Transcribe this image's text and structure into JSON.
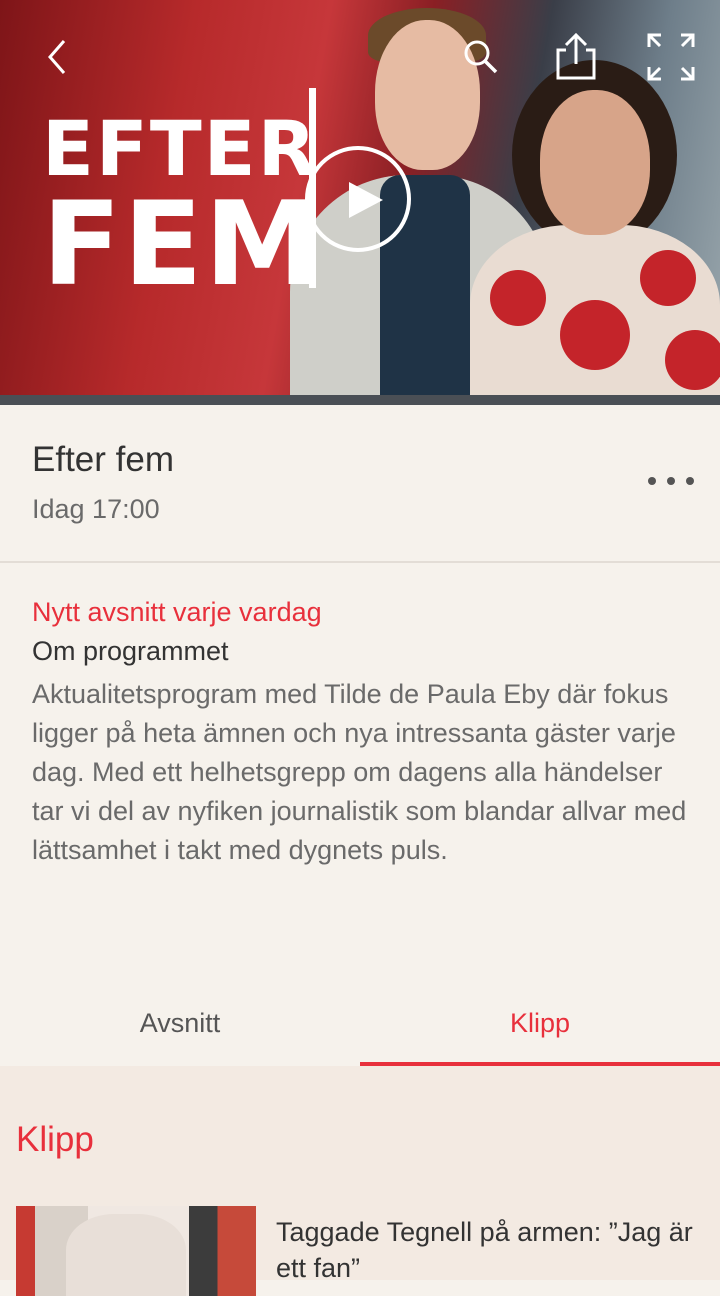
{
  "hero": {
    "logo_line1": "EFTER",
    "logo_line2": "FEM",
    "icons": [
      "back-icon",
      "search-icon",
      "share-icon",
      "fullscreen-icon",
      "play-icon"
    ]
  },
  "program": {
    "title": "Efter fem",
    "airtime": "Idag 17:00"
  },
  "about": {
    "tagline": "Nytt avsnitt varje vardag",
    "heading": "Om programmet",
    "text": "Aktualitetsprogram med Tilde de Paula Eby där fokus ligger på heta ämnen och nya intressanta gäster varje dag. Med ett helhetsgrepp om dagens alla händelser tar vi del av nyfiken journalistik som blandar allvar med lättsamhet i takt med dygnets puls."
  },
  "tabs": [
    {
      "label": "Avsnitt",
      "active": false
    },
    {
      "label": "Klipp",
      "active": true
    }
  ],
  "clips": {
    "section_title": "Klipp",
    "items": [
      {
        "title": "Taggade Tegnell på armen: ”Jag är ett fan”"
      }
    ]
  },
  "colors": {
    "accent": "#e8303c",
    "background": "#f6f2ec",
    "section_bg": "#f3eae2"
  }
}
